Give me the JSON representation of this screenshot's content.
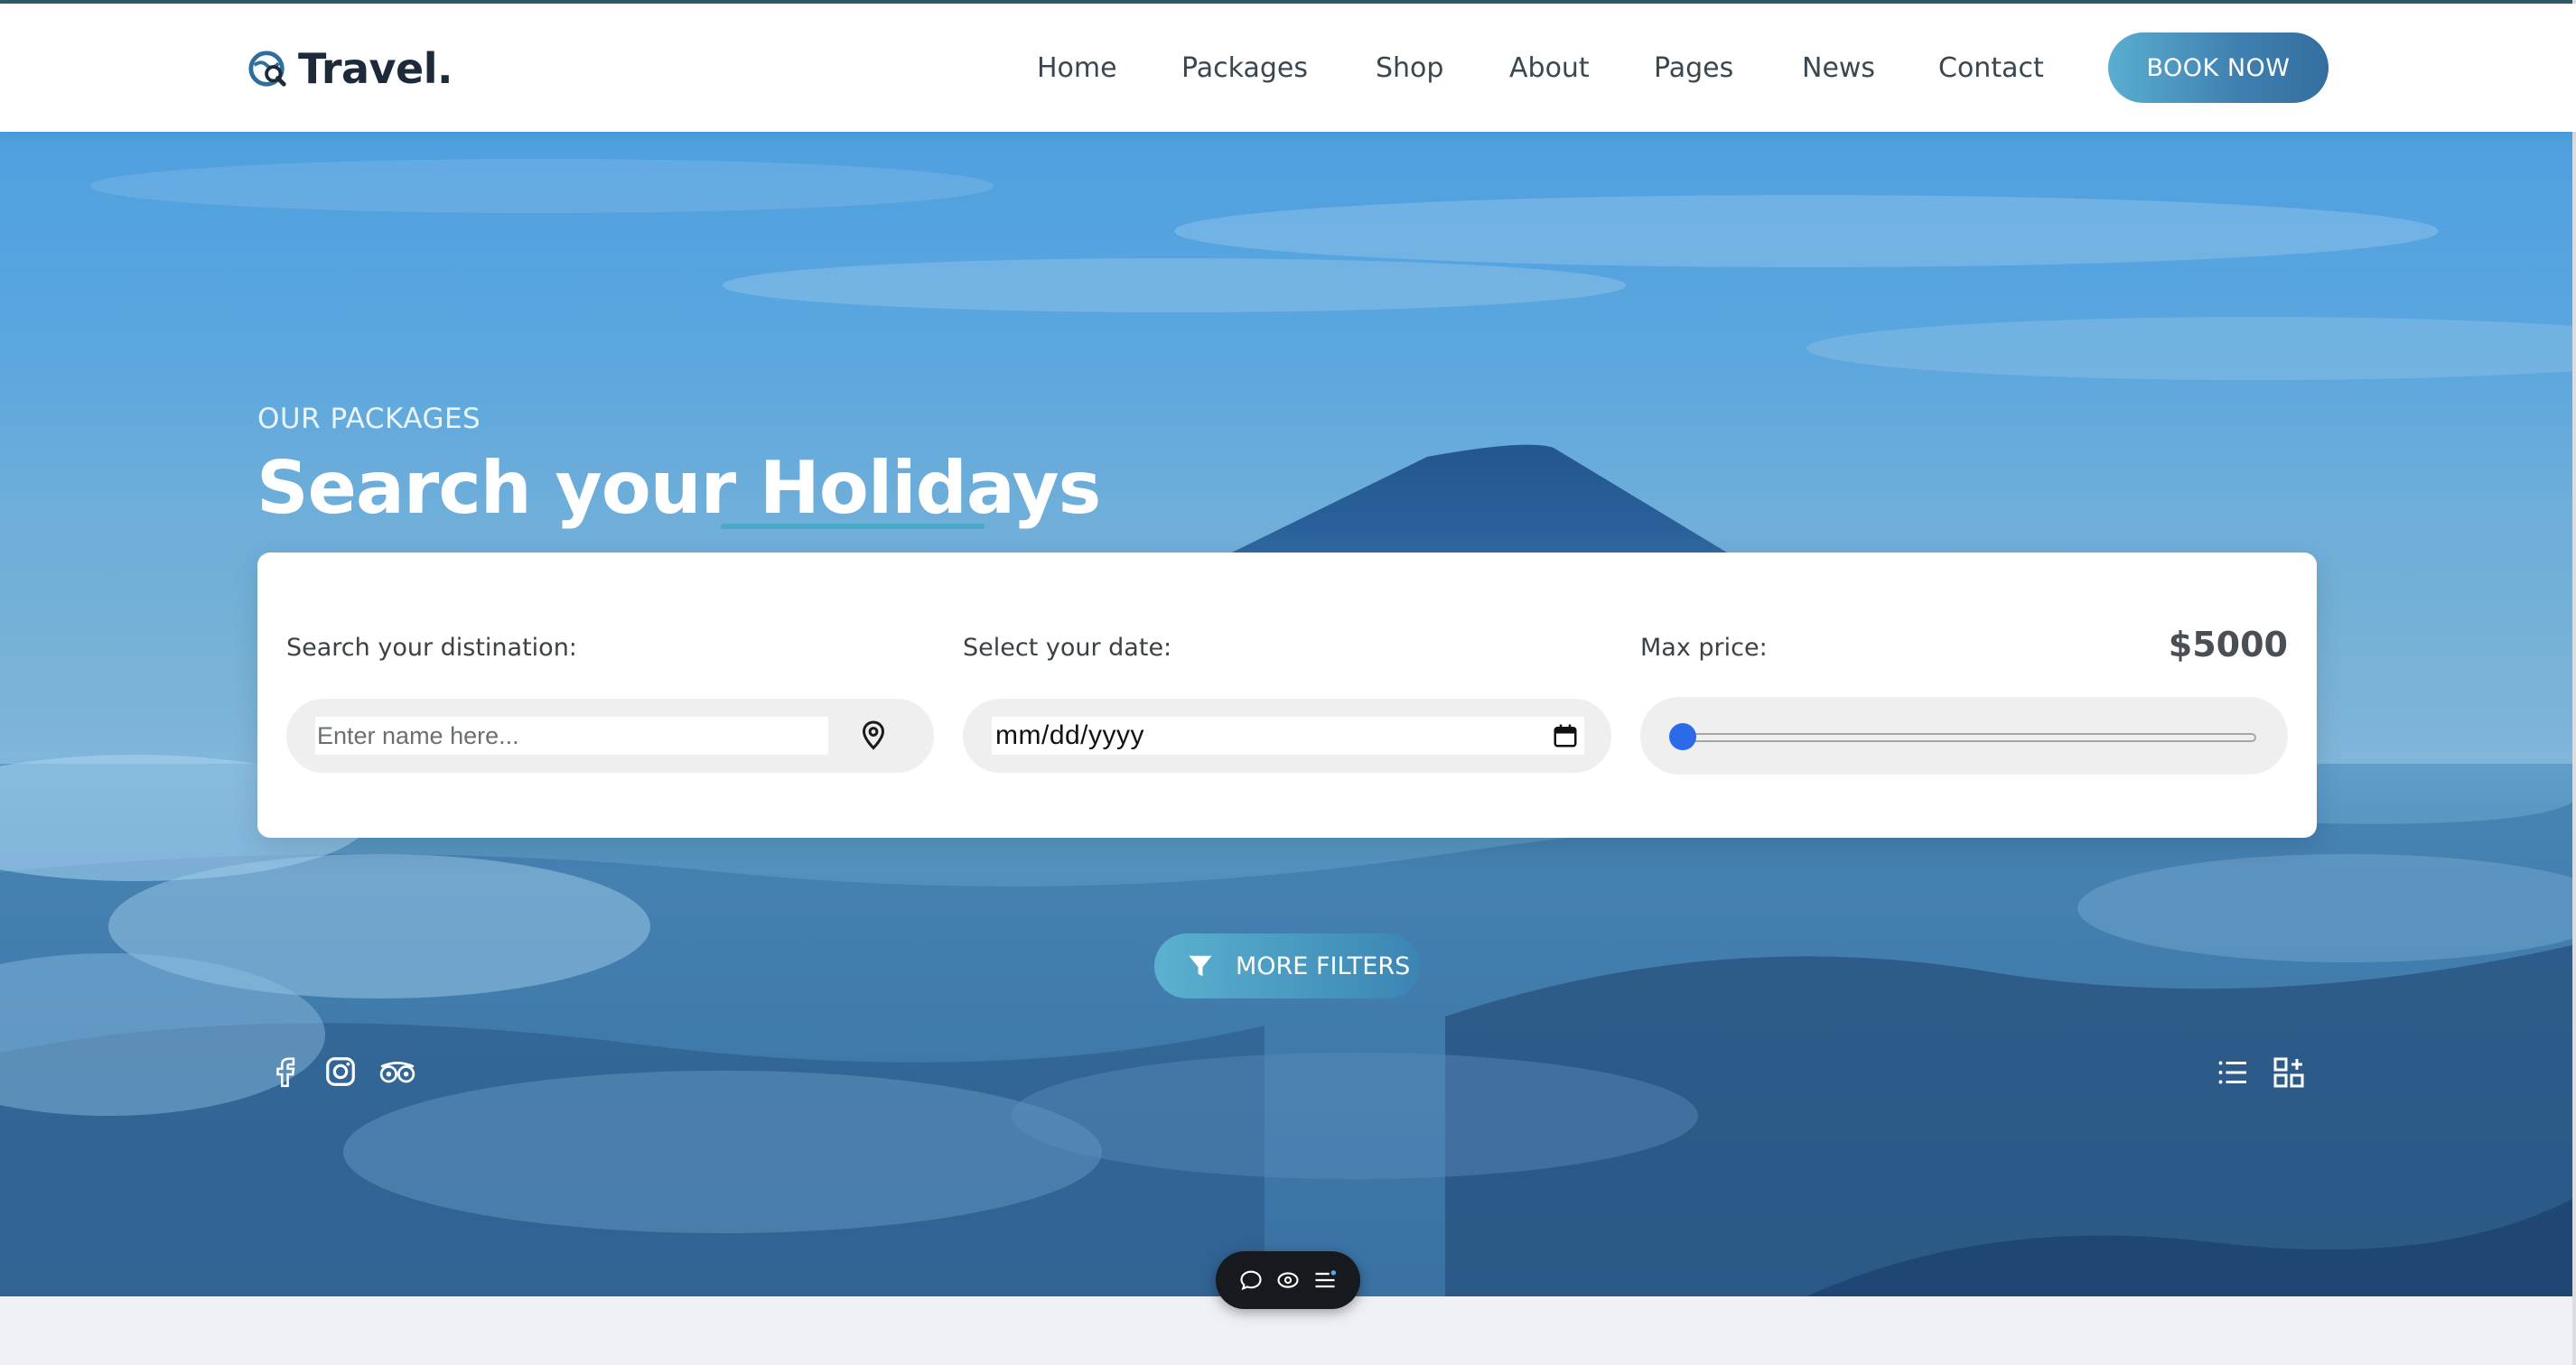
{
  "brand": {
    "name": "Travel."
  },
  "nav": {
    "items": [
      {
        "label": "Home"
      },
      {
        "label": "Packages"
      },
      {
        "label": "Shop"
      },
      {
        "label": "About"
      },
      {
        "label": "Pages"
      },
      {
        "label": "News"
      },
      {
        "label": "Contact"
      }
    ],
    "cta_label": "BOOK NOW"
  },
  "hero": {
    "eyebrow": "OUR PACKAGES",
    "title_part1": "Search your ",
    "title_part2": "Holidays"
  },
  "search": {
    "destination_label": "Search your distination:",
    "destination_placeholder": "Enter name here...",
    "date_label": "Select your date:",
    "date_value": "mm/dd/yyyy",
    "price_label": "Max price:",
    "price_value": "$5000",
    "price_slider_level": 0,
    "more_filters_label": "MORE FILTERS"
  },
  "social": [
    "facebook-icon",
    "instagram-icon",
    "tripadvisor-icon"
  ],
  "view_toggles": [
    "list-view-icon",
    "grid-view-icon"
  ],
  "float_toolbar": [
    "comment-icon",
    "preview-icon",
    "menu-icon"
  ],
  "colors": {
    "accent": "#4aa8c9",
    "button_gradient_start": "#5aaed0",
    "button_gradient_end": "#336e9e",
    "slider_thumb": "#2b6ae8",
    "heading_dark": "#1c2a3a"
  }
}
